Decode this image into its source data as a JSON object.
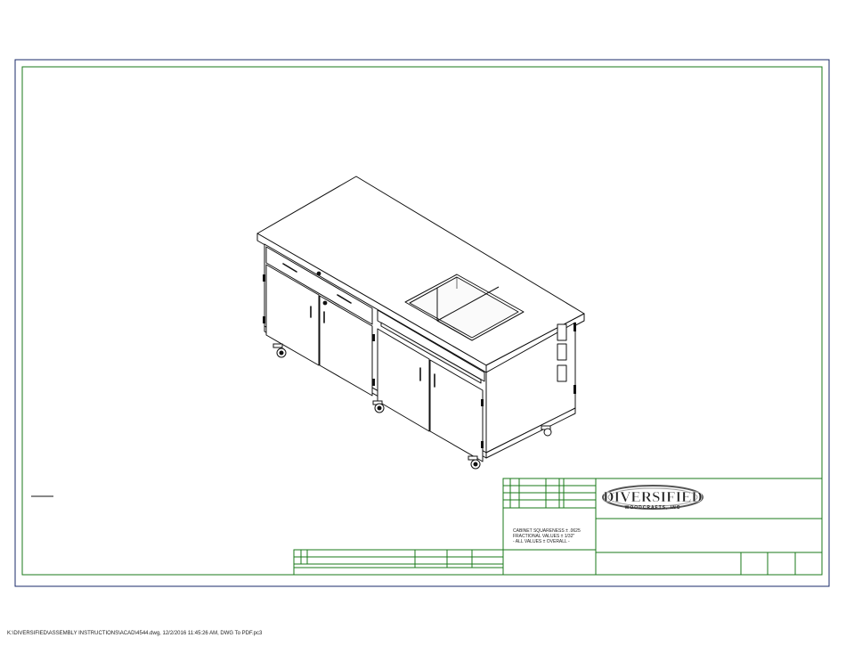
{
  "colors": {
    "border": "#1a7a1a",
    "outer_border": "#1a2a6a",
    "ink": "#111111"
  },
  "logo": {
    "name": "DIVERSIFIED",
    "subtitle": "WOODCRAFTS, INC"
  },
  "notes": {
    "line1": "CABINET SQUARENESS ± .0625",
    "line2": "FRACTIONAL VALUES ± 1/32\"",
    "line3": "- ALL VALUES ± OVERALL -"
  },
  "footer_path": "K:\\DIVERSIFIED\\ASSEMBLY INSTRUCTIONS\\ACAD\\4544.dwg, 12/2/2016 11:45:26 AM, DWG To PDF.pc3"
}
